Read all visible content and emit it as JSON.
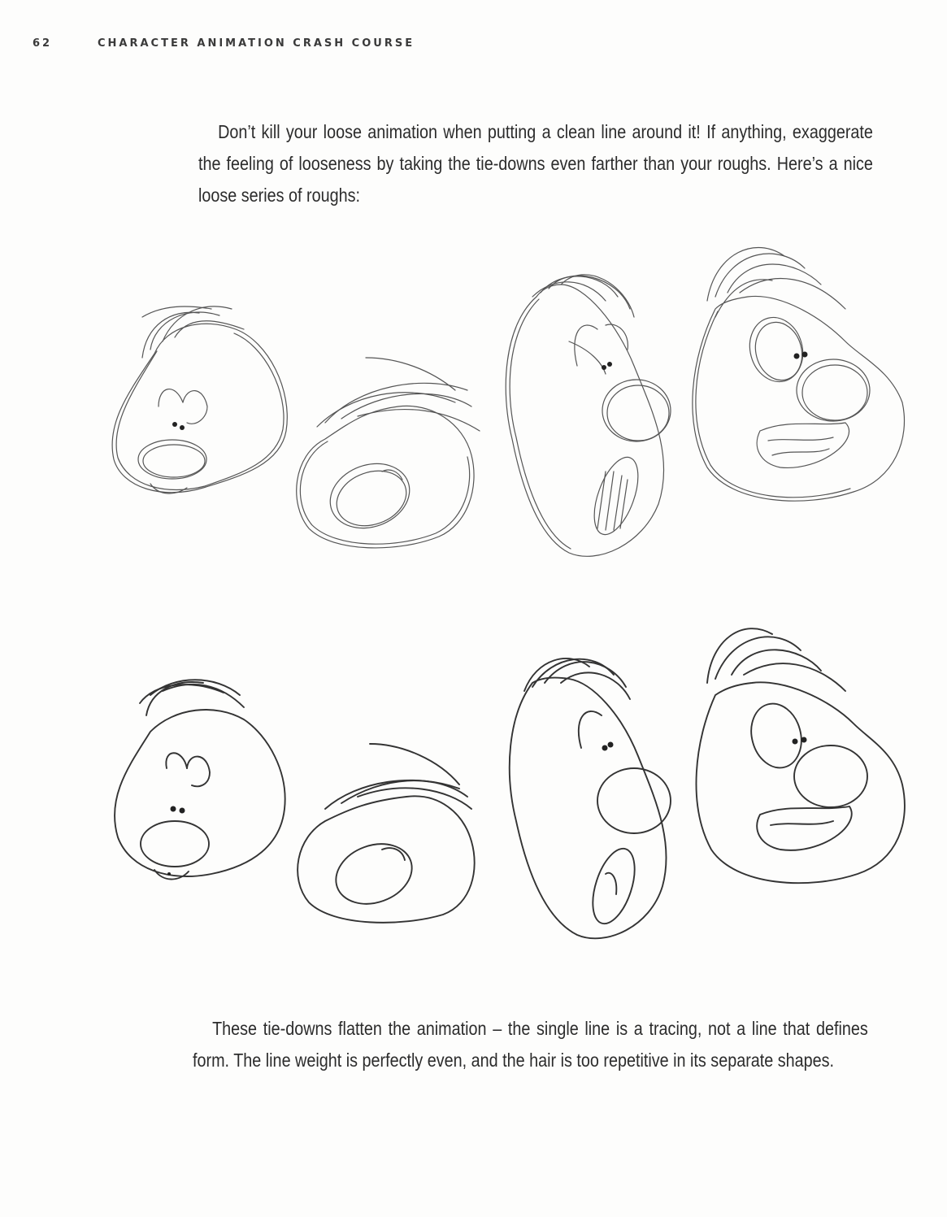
{
  "header": {
    "page_number": "62",
    "running_title": "CHARACTER ANIMATION CRASH COURSE"
  },
  "body": {
    "intro_paragraph": "Don’t kill your loose animation when putting a clean line around it! If anything, exaggerate the feeling of looseness by taking the tie-downs even farther than your roughs. Here’s a nice loose series of roughs:",
    "closing_paragraph": "These tie-downs flatten the animation – the single line is a tracing, not a line that defines form. The line weight is perfectly even, and the hair is too repetitive in its separate shapes."
  },
  "illustrations": {
    "rough_row": {
      "style": "loose pencil roughs",
      "frame_count": 4
    },
    "clean_row": {
      "style": "even-weight tie-downs",
      "frame_count": 4
    }
  }
}
